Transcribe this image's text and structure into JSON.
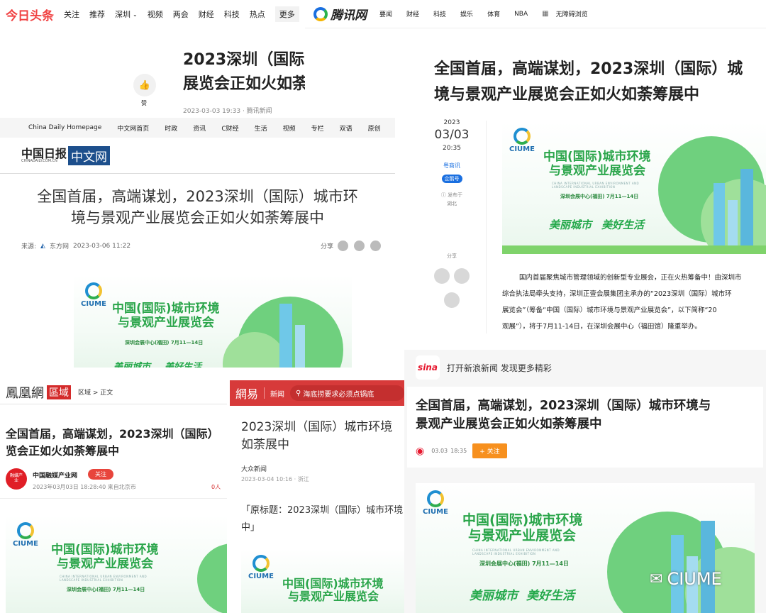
{
  "toutiao": {
    "logo": "今日头条",
    "nav": [
      "关注",
      "推荐",
      "深圳",
      "视频",
      "两会",
      "财经",
      "科技",
      "热点",
      "更多"
    ],
    "like_label": "赞",
    "title": "2023深圳（国际）城市环境与景观产业展览会正如火如荼",
    "title_line1": "2023深圳（国际",
    "title_line2": "展览会正如火如荼",
    "meta": "2023-03-03 19:33 · 腾讯新闻"
  },
  "tencent": {
    "logo": "腾讯网",
    "nav": [
      "要闻",
      "财经",
      "科技",
      "娱乐",
      "体育",
      "NBA"
    ],
    "access": "无障碍浏览",
    "title_line1": "全国首届，高端谋划，2023深圳（国际）城",
    "title_line2": "境与景观产业展览会正如火如荼筹展中",
    "year": "2023",
    "date": "03/03",
    "time": "20:35",
    "author": "粤商讯",
    "badge": "企鹅号",
    "location_label": "发布于",
    "location": "湖北",
    "share_label": "分享",
    "body": [
      "国内首届聚焦城市管理领域的创新型专业展会，正在火热筹备中！由深圳市",
      "综合执法局牵头支持，深圳正壹会展集团主承办的“2023深圳（国际）城市环",
      "展览会”（筹备“中国（国际）城市环境与景观产业展览会”，以下简称“20",
      "观展”），将于7月11-14日，在深圳会展中心（福田馆）隆重举办。"
    ]
  },
  "chinadaily": {
    "nav": [
      "China Daily Homepage",
      "中文网首页",
      "时政",
      "资讯",
      "C财经",
      "生活",
      "视频",
      "专栏",
      "双语",
      "原创"
    ],
    "logo_cn": "中国日报",
    "logo_url": "CHINADAILY.COM.CN",
    "logo_tag": "中文网",
    "title_line1": "全国首届，高端谋划，2023深圳（国际）城市环",
    "title_line2": "境与景观产业展览会正如火如荼筹展中",
    "source_label": "来源:",
    "source": "东方网",
    "date": "2023-03-06 11:22",
    "share_label": "分享"
  },
  "ifeng": {
    "logo": "鳳凰網",
    "tag": "區域",
    "crumb": "区域 > 正文",
    "title_line1": "全国首届，高端谋划，2023深圳（国际）",
    "title_line2": "览会正如火如荼筹展中",
    "avatar_text": "融媒产业",
    "author": "中国融媒产业网",
    "follow": "关注",
    "meta": "2023年03月03日 18:28:40 来自北京市",
    "count": "0人"
  },
  "netease": {
    "logo": "網易",
    "channel": "新闻",
    "search": "海底捞要求必须点锅底",
    "title_line1": "2023深圳（国际）城市环境",
    "title_line2": "如荼展中",
    "source": "大众新闻",
    "meta": "2023-03-04 10:16 · 浙江",
    "quote_line1": "「原标题：2023深圳（国际）城市环境",
    "quote_line2": "中」"
  },
  "sina": {
    "logo": "sina",
    "slogan": "打开新浪新闻 发现更多精彩",
    "title_line1": "全国首届，高端谋划，2023深圳（国际）城市环境与",
    "title_line2": "景观产业展览会正如火如荼筹展中",
    "date": "03.03",
    "time": "18:35",
    "follow": "+ 关注"
  },
  "poster": {
    "logo": "CIUME",
    "title_line1": "中国(国际)城市环境",
    "title_line2": "与景观产业展览会",
    "en_line1": "CHINA INTERNATIONAL URBAN ENVIRONMENT AND",
    "en_line2": "LANDSCAPE INDUSTRIAL EXHIBITION",
    "venue": "深圳会展中心(福田)  7月11—14日",
    "slogan1": "美丽城市",
    "slogan2": "美好生活"
  },
  "watermark": "CIUME",
  "colors": {
    "toutiao_red": "#f04142",
    "tencent_blue": "#1a6fe0",
    "ifeng_red": "#d42b2b",
    "netease_red": "#d73a3a",
    "sina_orange": "#f7901e",
    "poster_green": "#2aa54a"
  }
}
